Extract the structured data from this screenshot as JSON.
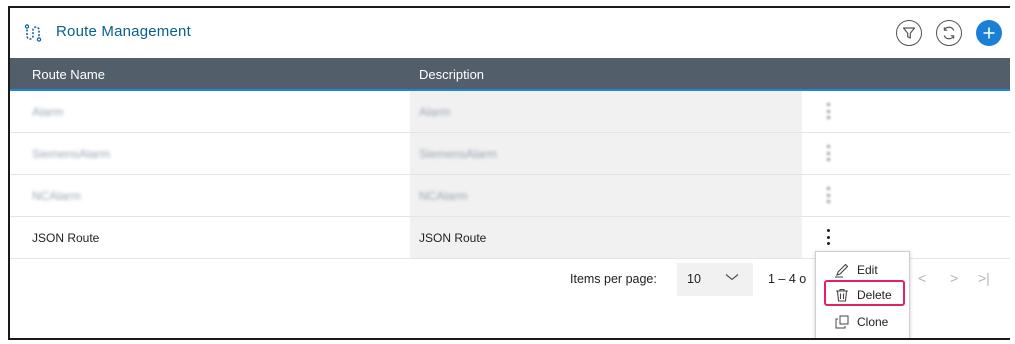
{
  "header": {
    "title": "Route Management",
    "title_icon": "route-icon",
    "actions": [
      {
        "name": "filter",
        "icon": "filter-icon"
      },
      {
        "name": "refresh",
        "icon": "refresh-icon"
      },
      {
        "name": "add",
        "icon": "plus-icon"
      }
    ]
  },
  "table": {
    "columns": [
      "Route Name",
      "Description"
    ],
    "rows": [
      {
        "name": "Alarm",
        "description": "Alarm",
        "blurred": true
      },
      {
        "name": "SiemensAlarm",
        "description": "SiemensAlarm",
        "blurred": true
      },
      {
        "name": "NCAlarm",
        "description": "NCAlarm",
        "blurred": true
      },
      {
        "name": "JSON Route",
        "description": "JSON Route",
        "blurred": false
      }
    ]
  },
  "pagination": {
    "items_per_page_label": "Items per page:",
    "items_per_page_value": "10",
    "range_text": "1 – 4 o",
    "nav": [
      "<",
      ">",
      ">|"
    ]
  },
  "context_menu": {
    "items": [
      {
        "label": "Edit",
        "icon": "pencil-icon"
      },
      {
        "label": "Delete",
        "icon": "trash-icon",
        "highlighted": true
      },
      {
        "label": "Clone",
        "icon": "clone-icon"
      }
    ]
  },
  "colors": {
    "accent": "#1b7fd6",
    "title": "#0a5e8f",
    "header_bg": "#525f6b",
    "highlight": "#e0245e"
  }
}
